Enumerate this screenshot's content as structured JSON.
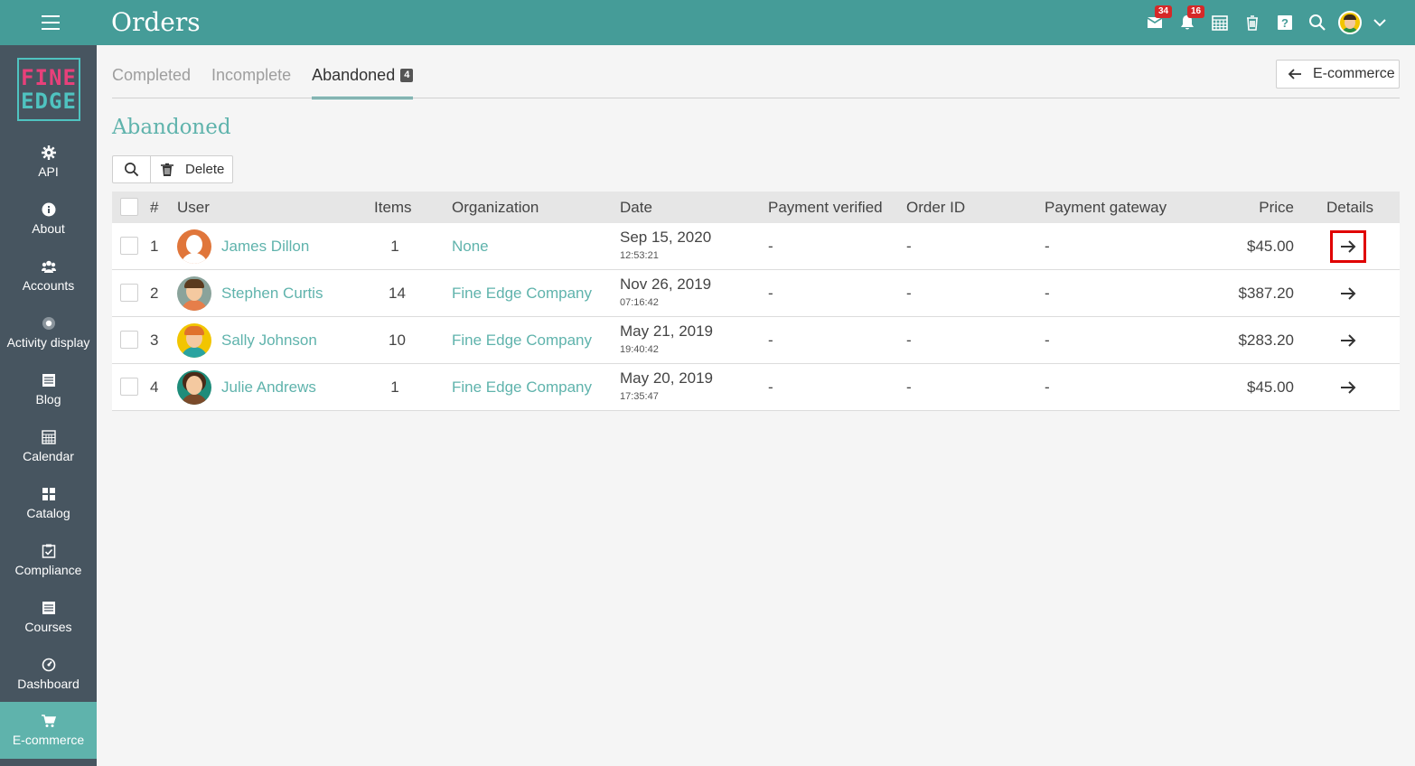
{
  "header": {
    "title": "Orders",
    "mail_badge": "34",
    "notif_badge": "16"
  },
  "sidebar": {
    "logo_top": "FINE",
    "logo_bottom": "EDGE",
    "items": [
      {
        "label": "API",
        "icon": "gear-icon"
      },
      {
        "label": "About",
        "icon": "info-icon"
      },
      {
        "label": "Accounts",
        "icon": "users-icon"
      },
      {
        "label": "Activity display",
        "icon": "dot-icon"
      },
      {
        "label": "Blog",
        "icon": "document-icon"
      },
      {
        "label": "Calendar",
        "icon": "calendar-icon"
      },
      {
        "label": "Catalog",
        "icon": "grid-icon"
      },
      {
        "label": "Compliance",
        "icon": "checklist-icon"
      },
      {
        "label": "Courses",
        "icon": "courses-icon"
      },
      {
        "label": "Dashboard",
        "icon": "gauge-icon"
      },
      {
        "label": "E-commerce",
        "icon": "cart-icon"
      }
    ]
  },
  "tabs": [
    {
      "label": "Completed"
    },
    {
      "label": "Incomplete"
    },
    {
      "label": "Abandoned",
      "count": "4"
    }
  ],
  "back_button": {
    "label": "E-commerce"
  },
  "page": {
    "heading": "Abandoned"
  },
  "toolbar": {
    "delete_label": "Delete"
  },
  "table": {
    "columns": {
      "num": "#",
      "user": "User",
      "items": "Items",
      "organization": "Organization",
      "date": "Date",
      "payment_verified": "Payment verified",
      "order_id": "Order ID",
      "payment_gateway": "Payment gateway",
      "price": "Price",
      "details": "Details"
    },
    "rows": [
      {
        "num": "1",
        "user": "James Dillon",
        "items": "1",
        "organization": "None",
        "date": "Sep 15, 2020",
        "time": "12:53:21",
        "payment_verified": "-",
        "order_id": "-",
        "payment_gateway": "-",
        "price": "$45.00"
      },
      {
        "num": "2",
        "user": "Stephen Curtis",
        "items": "14",
        "organization": "Fine Edge Company",
        "date": "Nov 26, 2019",
        "time": "07:16:42",
        "payment_verified": "-",
        "order_id": "-",
        "payment_gateway": "-",
        "price": "$387.20"
      },
      {
        "num": "3",
        "user": "Sally Johnson",
        "items": "10",
        "organization": "Fine Edge Company",
        "date": "May 21, 2019",
        "time": "19:40:42",
        "payment_verified": "-",
        "order_id": "-",
        "payment_gateway": "-",
        "price": "$283.20"
      },
      {
        "num": "4",
        "user": "Julie Andrews",
        "items": "1",
        "organization": "Fine Edge Company",
        "date": "May 20, 2019",
        "time": "17:35:47",
        "payment_verified": "-",
        "order_id": "-",
        "payment_gateway": "-",
        "price": "$45.00"
      }
    ]
  },
  "colors": {
    "topbar": "#459c98",
    "sidebar": "#475560",
    "accent": "#5fb3ac",
    "badge": "#d62828",
    "highlight": "#e00000"
  }
}
